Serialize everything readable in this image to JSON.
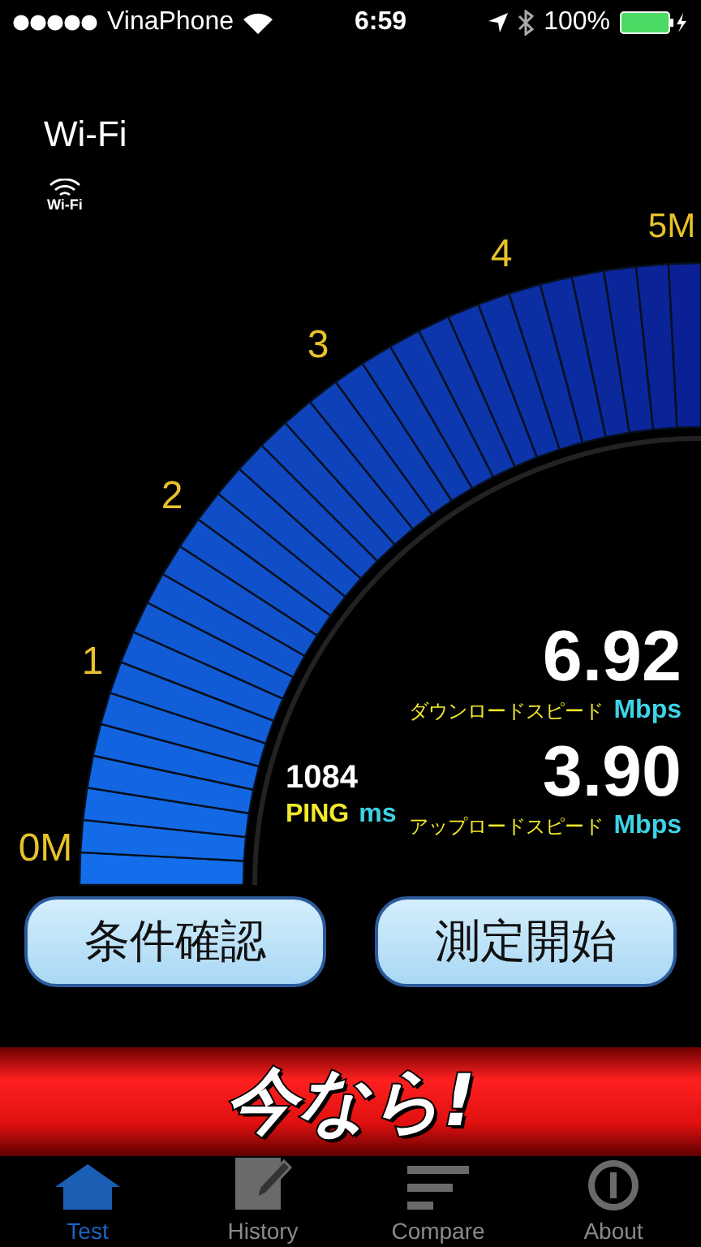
{
  "status_bar": {
    "carrier": "VinaPhone",
    "time": "6:59",
    "battery": "100%"
  },
  "connection": {
    "title": "Wi-Fi",
    "icon_label": "Wi-Fi"
  },
  "gauge": {
    "ticks": [
      "0M",
      "1",
      "2",
      "3",
      "4",
      "5M"
    ]
  },
  "readouts": [
    {
      "value": "6.92",
      "label": "ダウンロードスピード",
      "unit": "Mbps"
    },
    {
      "value": "3.90",
      "label": "アップロードスピード",
      "unit": "Mbps"
    }
  ],
  "ping": {
    "value": "1084",
    "label": "PING",
    "unit": "ms"
  },
  "buttons": [
    "条件確認",
    "測定開始"
  ],
  "banner": "今なら!",
  "tabs": [
    {
      "label": "Test",
      "kind": "home",
      "selected": true
    },
    {
      "label": "History",
      "kind": "notes",
      "selected": false
    },
    {
      "label": "Compare",
      "kind": "bars",
      "selected": false
    },
    {
      "label": "About",
      "kind": "info",
      "selected": false
    }
  ]
}
